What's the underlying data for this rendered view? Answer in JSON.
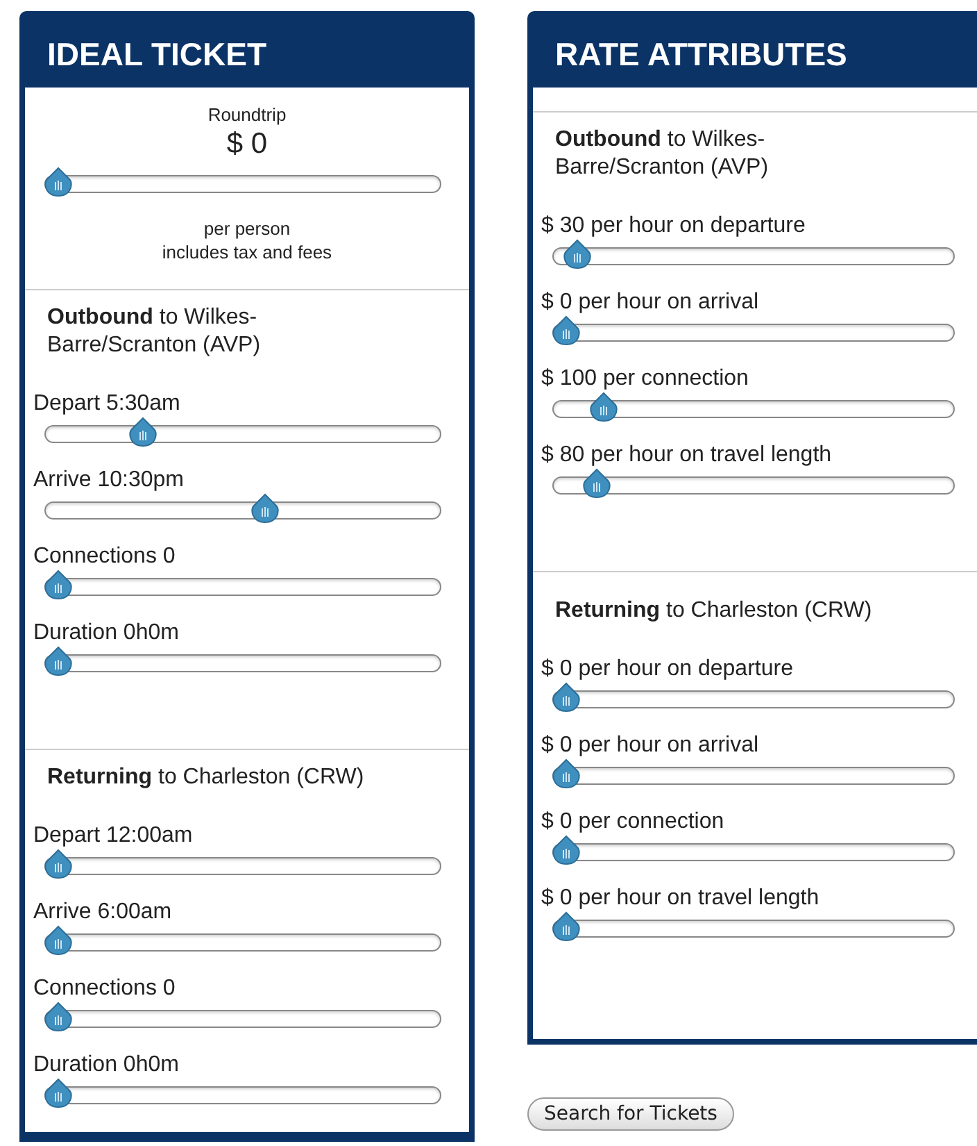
{
  "panels": [
    {
      "title": "IDEAL TICKET",
      "summary": {
        "caption": "Roundtrip",
        "price": "$ 0",
        "level": 0,
        "notes": [
          "per person",
          "includes tax and fees"
        ]
      },
      "sections": [
        {
          "heading": "**Outbound** to Wilkes-Barre/Scranton (AVP)",
          "sliders": [
            {
              "label": "Depart 5:30am",
              "level": 0.23
            },
            {
              "label": "Arrive 10:30pm",
              "level": 0.56
            },
            {
              "label": "Connections 0",
              "level": 0
            },
            {
              "label": "Duration 0h0m",
              "level": 0
            }
          ]
        },
        {
          "heading": "**Returning** to Charleston (CRW)",
          "sliders": [
            {
              "label": "Depart 12:00am",
              "level": 0
            },
            {
              "label": "Arrive 6:00am",
              "level": 0
            },
            {
              "label": "Connections 0",
              "level": 0
            },
            {
              "label": "Duration 0h0m",
              "level": 0
            }
          ]
        }
      ]
    },
    {
      "title": "RATE ATTRIBUTES",
      "sections": [
        {
          "heading": "**Outbound** to Wilkes-Barre/Scranton (AVP)",
          "sliders": [
            {
              "label": "$ 30 per hour on departure",
              "level": 0.03
            },
            {
              "label": "$ 0 per hour on arrival",
              "level": 0
            },
            {
              "label": "$ 100 per connection",
              "level": 0.1
            },
            {
              "label": "$ 80 per hour on travel length",
              "level": 0.08
            }
          ]
        },
        {
          "heading": "**Returning** to Charleston (CRW)",
          "sliders": [
            {
              "label": "$ 0 per hour on departure",
              "level": 0
            },
            {
              "label": "$ 0 per hour on arrival",
              "level": 0
            },
            {
              "label": "$ 0 per connection",
              "level": 0
            },
            {
              "label": "$ 0 per hour on travel length",
              "level": 0
            }
          ]
        }
      ]
    }
  ],
  "button": "Search for Tickets"
}
